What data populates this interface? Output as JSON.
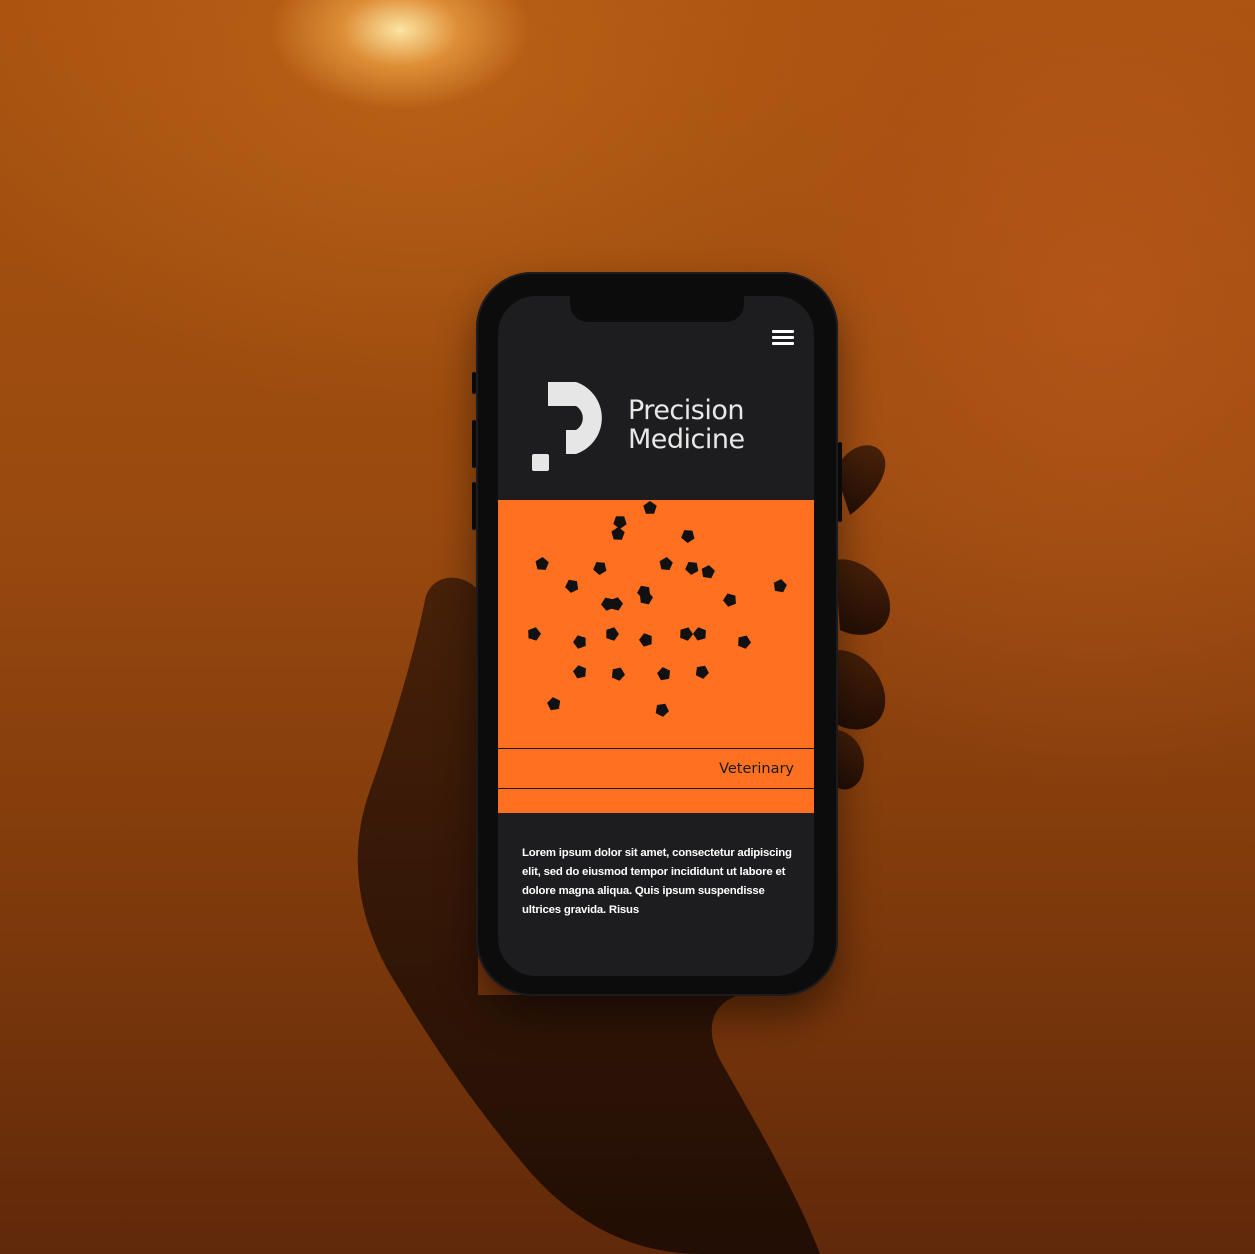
{
  "brand": {
    "line1": "Precision",
    "line2": "Medicine"
  },
  "category": {
    "label": "Veterinary"
  },
  "body": {
    "text": "Lorem ipsum dolor sit amet, consectetur adipiscing elit, sed do eiusmod tempor incididunt ut labore et dolore magna aliqua. Quis ipsum suspendisse ultrices gravida. Risus"
  },
  "icons": {
    "menu": "hamburger-menu-icon",
    "logo": "precision-medicine-logo-mark"
  },
  "colors": {
    "accent": "#ff7020",
    "screen_bg": "#1d1d1f",
    "text_light": "#e8e8e8",
    "text_dark": "#1a1a1a"
  }
}
